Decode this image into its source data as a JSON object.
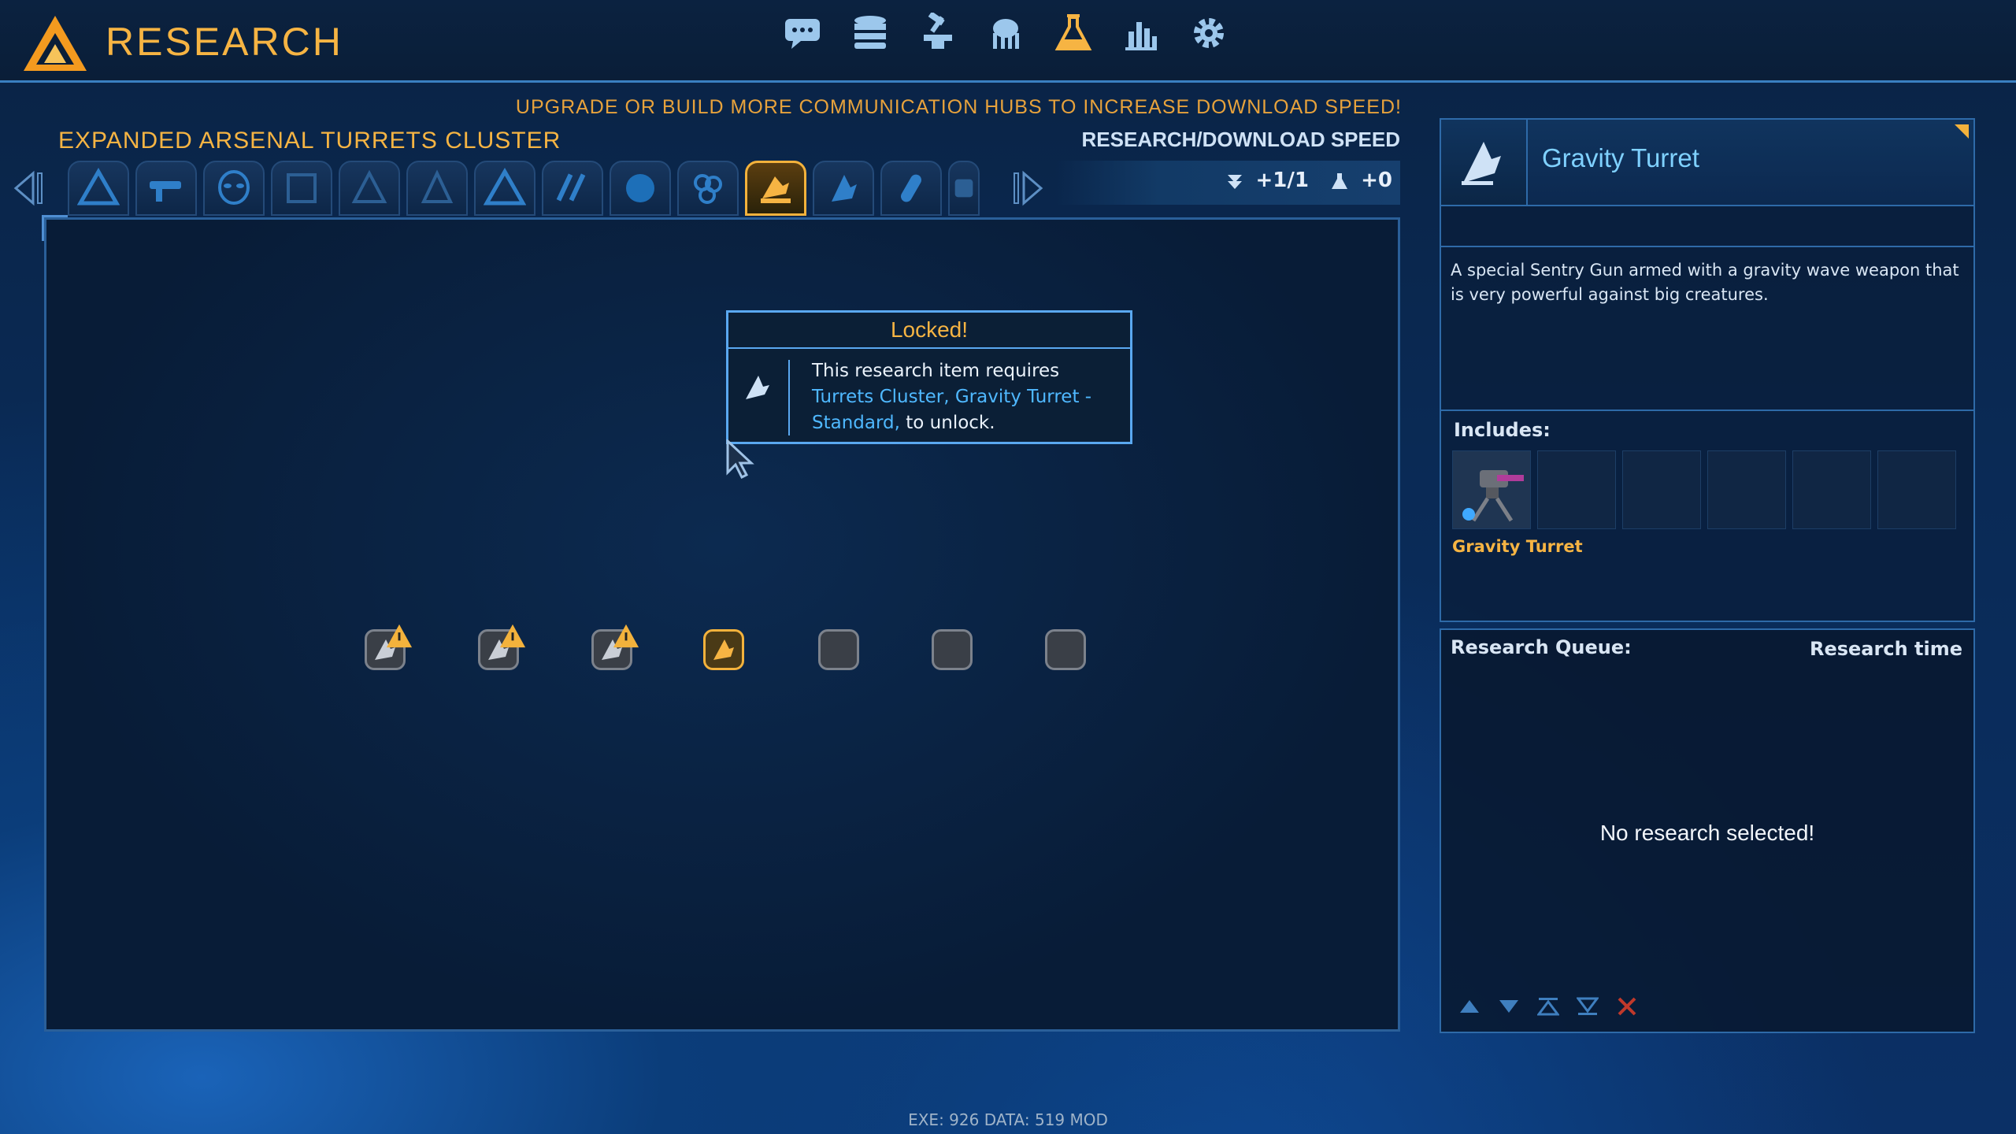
{
  "header": {
    "title": "RESEARCH",
    "nav": [
      "chat-icon",
      "database-icon",
      "anvil-icon",
      "creature-icon",
      "flask-icon",
      "stats-icon",
      "settings-icon"
    ]
  },
  "hint": "UPGRADE OR BUILD MORE COMMUNICATION HUBS TO INCREASE DOWNLOAD SPEED!",
  "cluster_title": "EXPANDED ARSENAL TURRETS CLUSTER",
  "speed": {
    "label": "RESEARCH/DOWNLOAD SPEED",
    "download": "+1/1",
    "research": "+0"
  },
  "colors": {
    "accent": "#f6b443",
    "link": "#4fb8ff",
    "border": "#2e6aa8"
  },
  "tooltip": {
    "title": "Locked!",
    "line1": "This research item requires",
    "requirements": "Turrets Cluster, Gravity Turret - Standard,",
    "suffix": "to unlock."
  },
  "info": {
    "title": "Gravity Turret",
    "description": "A special Sentry Gun armed with a gravity wave weapon that is very powerful against big creatures.",
    "includes_label": "Includes:",
    "item_name": "Gravity Turret"
  },
  "queue": {
    "label": "Research Queue:",
    "time_label": "Research time",
    "empty": "No research selected!"
  },
  "footer": "EXE: 926 DATA: 519 MOD"
}
